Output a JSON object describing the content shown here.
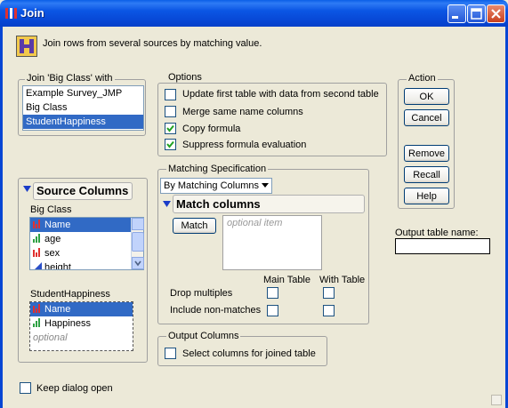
{
  "window": {
    "title": "Join"
  },
  "description": "Join rows from several sources by matching value.",
  "join_group": {
    "label": "Join 'Big Class' with",
    "items": [
      "Example Survey_JMP",
      "Big Class",
      "StudentHappiness"
    ],
    "selected_index": 2
  },
  "source_columns": {
    "title": "Source Columns",
    "table1": {
      "name": "Big Class",
      "columns": [
        {
          "name": "Name",
          "type": "nominal-icon",
          "selected": true
        },
        {
          "name": "age",
          "type": "ordinal-icon",
          "selected": false
        },
        {
          "name": "sex",
          "type": "nominal-icon",
          "selected": false
        },
        {
          "name": "height",
          "type": "continuous-icon",
          "selected": false
        }
      ]
    },
    "table2": {
      "name": "StudentHappiness",
      "columns": [
        {
          "name": "Name",
          "type": "nominal-icon",
          "selected": true
        },
        {
          "name": "Happiness",
          "type": "ordinal-icon",
          "selected": false
        }
      ],
      "optional": "optional"
    }
  },
  "options": {
    "label": "Options",
    "items": [
      {
        "label": "Update first table with data from second table",
        "checked": false
      },
      {
        "label": "Merge same name columns",
        "checked": false
      },
      {
        "label": "Copy formula",
        "checked": true
      },
      {
        "label": "Suppress formula evaluation",
        "checked": true
      }
    ]
  },
  "matching": {
    "label": "Matching Specification",
    "method": "By Matching Columns",
    "match_columns_title": "Match columns",
    "match_button": "Match",
    "optional_item": "optional item",
    "main_table": "Main Table",
    "with_table": "With Table",
    "drop_multiples": "Drop multiples",
    "include_non_matches": "Include non-matches"
  },
  "output_columns": {
    "label": "Output Columns",
    "select_label": "Select columns for joined table"
  },
  "action": {
    "label": "Action",
    "ok": "OK",
    "cancel": "Cancel",
    "remove": "Remove",
    "recall": "Recall",
    "help": "Help"
  },
  "output_table_name": {
    "label": "Output table name:",
    "value": ""
  },
  "keep_dialog_open": "Keep dialog open",
  "colors": {
    "titlebar": "#0A5FE7",
    "selection": "#316AC5",
    "background": "#ECE9D8"
  }
}
